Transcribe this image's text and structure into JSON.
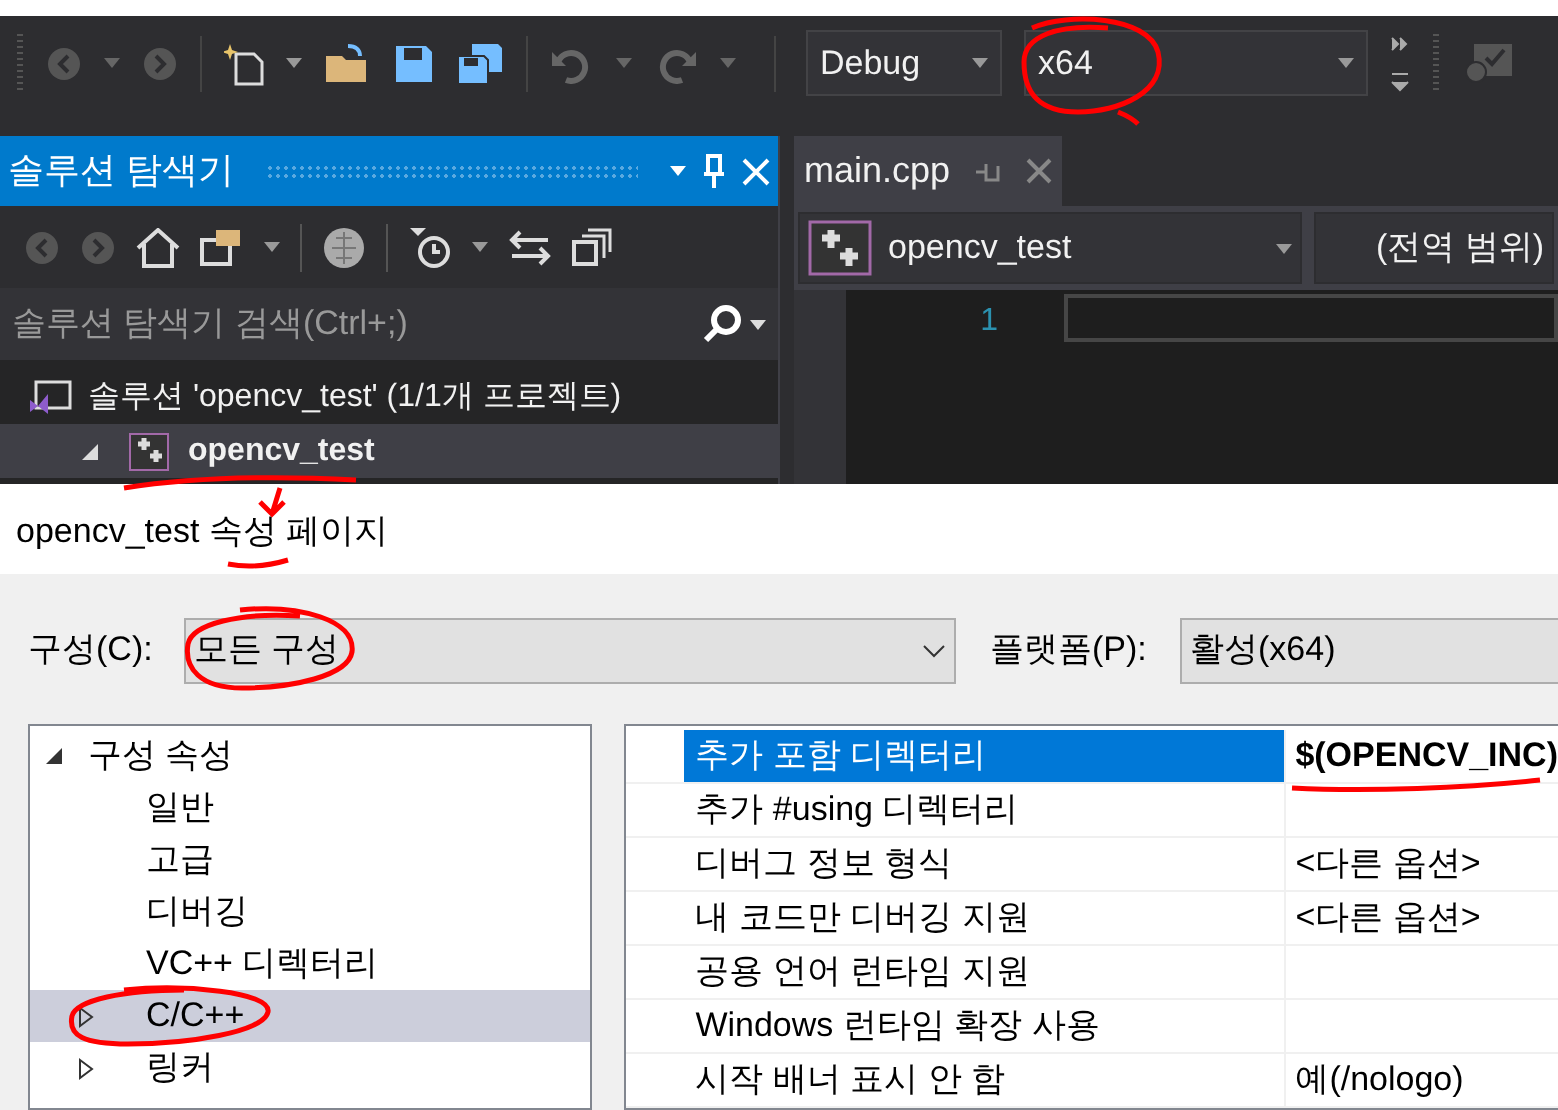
{
  "toolbar": {
    "configuration": "Debug",
    "platform": "x64"
  },
  "solution_explorer": {
    "title": "솔루션 탐색기",
    "search": {
      "placeholder": "솔루션 탐색기 검색(Ctrl+;)"
    },
    "tree": [
      {
        "label": "솔루션 'opencv_test' (1/1개 프로젝트)",
        "kind": "solution",
        "bold": false,
        "expanded": true,
        "children": [
          {
            "label": "opencv_test",
            "kind": "project",
            "bold": true,
            "expanded": true
          }
        ]
      }
    ]
  },
  "editor": {
    "tabs": [
      {
        "label": "main.cpp",
        "selected": true
      }
    ],
    "project_dropdown": "opencv_test",
    "scope_dropdown": "(전역 범위)",
    "line_numbers": [
      "1"
    ]
  },
  "property_page": {
    "title": "opencv_test 속성 페이지",
    "configuration_label": "구성(C):",
    "configuration": "모든 구성",
    "platform_label": "플랫폼(P):",
    "platform": "활성(x64)",
    "tree": [
      {
        "label": "구성 속성",
        "expanded": true,
        "selected": false,
        "children": [
          {
            "label": "일반",
            "selected": false
          },
          {
            "label": "고급",
            "selected": false
          },
          {
            "label": "디버깅",
            "selected": false
          },
          {
            "label": "VC++ 디렉터리",
            "selected": false
          },
          {
            "label": "C/C++",
            "selected": true,
            "expanded": false
          },
          {
            "label": "링커",
            "selected": false,
            "expanded": false
          }
        ]
      }
    ],
    "properties": [
      {
        "name": "추가 포함 디렉터리",
        "value": "$(OPENCV_INC)",
        "selected": true,
        "modified": true
      },
      {
        "name": "추가 #using 디렉터리",
        "selected": false,
        "modified": false
      },
      {
        "name": "디버그 정보 형식",
        "value": "<다른 옵션>",
        "selected": false,
        "modified": false
      },
      {
        "name": "내 코드만 디버깅 지원",
        "value": "<다른 옵션>",
        "selected": false,
        "modified": false
      },
      {
        "name": "공용 언어 런타임 지원",
        "selected": false,
        "modified": false
      },
      {
        "name": "Windows 런타임 확장 사용",
        "selected": false,
        "modified": false
      },
      {
        "name": "시작 배너 표시 안 함",
        "value": "예(/nologo)",
        "selected": false,
        "modified": false
      }
    ]
  }
}
